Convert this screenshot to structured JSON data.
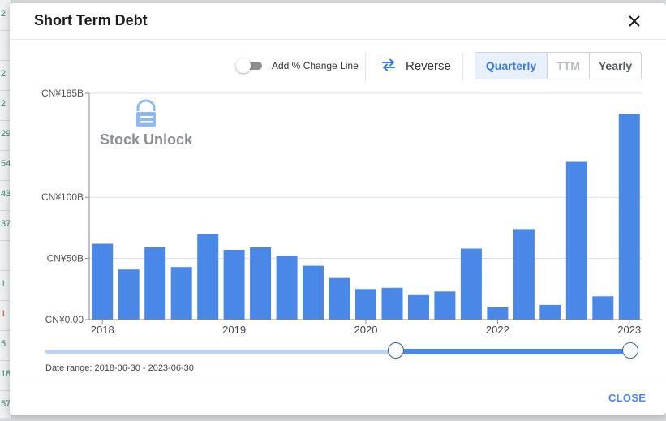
{
  "background": {
    "cells": [
      {
        "text": "2"
      },
      {
        "text": ""
      },
      {
        "text": "2"
      },
      {
        "text": "2"
      },
      {
        "text": "29"
      },
      {
        "text": "54"
      },
      {
        "text": "43"
      },
      {
        "text": "37"
      },
      {
        "text": ""
      },
      {
        "text": "1"
      },
      {
        "text": "1"
      },
      {
        "text": "5"
      },
      {
        "text": "18"
      },
      {
        "text": "57"
      }
    ]
  },
  "modal": {
    "title": "Short Term Debt",
    "close_icon": "close-icon",
    "close_label": "CLOSE"
  },
  "toolbar": {
    "change_line_label": "Add % Change Line",
    "change_line_enabled": false,
    "reverse_label": "Reverse",
    "reverse_icon": "swap-arrows-icon",
    "periods": [
      {
        "label": "Quarterly",
        "state": "active"
      },
      {
        "label": "TTM",
        "state": "disabled"
      },
      {
        "label": "Yearly",
        "state": "normal"
      }
    ]
  },
  "watermark": {
    "text": "Stock Unlock",
    "icon": "lock-logo-icon"
  },
  "chart_data": {
    "type": "bar",
    "bar_color": "#4a88e8",
    "x": [
      "2018-06-30",
      "2018-09-30",
      "2018-12-31",
      "2019-03-31",
      "2019-06-30",
      "2019-09-30",
      "2019-12-31",
      "2020-03-31",
      "2020-06-30",
      "2020-09-30",
      "2020-12-31",
      "2021-03-31",
      "2021-06-30",
      "2021-09-30",
      "2021-12-31",
      "2022-03-31",
      "2022-06-30",
      "2022-09-30",
      "2022-12-31",
      "2023-03-31",
      "2023-06-30"
    ],
    "values": [
      62,
      41,
      59,
      43,
      70,
      57,
      59,
      52,
      44,
      34,
      25,
      26,
      20,
      23,
      58,
      10,
      74,
      12,
      129,
      19,
      168
    ],
    "ylim": [
      0,
      185
    ],
    "yticks": [
      {
        "value": 0,
        "label": "CN¥0.00"
      },
      {
        "value": 50,
        "label": "CN¥50B"
      },
      {
        "value": 100,
        "label": "CN¥100B"
      },
      {
        "value": 185,
        "label": "CN¥185B"
      }
    ],
    "xticks": [
      {
        "index": 0,
        "label": "2018"
      },
      {
        "index": 5,
        "label": "2019"
      },
      {
        "index": 10,
        "label": "2020"
      },
      {
        "index": 15,
        "label": "2022"
      },
      {
        "index": 20,
        "label": "2023"
      }
    ],
    "grid": true
  },
  "range": {
    "start_fraction": 0.59,
    "end_fraction": 1.0,
    "label": "Date range: 2018-06-30 - 2023-06-30"
  }
}
